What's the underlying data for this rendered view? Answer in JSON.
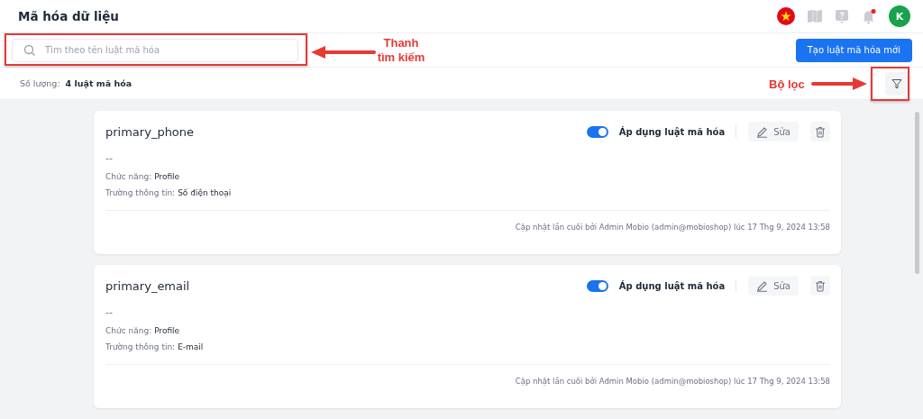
{
  "header": {
    "title": "Mã hóa dữ liệu",
    "notification_dot": true,
    "avatar": "K"
  },
  "search": {
    "placeholder": "Tìm theo tên luật mã hóa"
  },
  "create_button": "Tạo luật mã hóa mới",
  "summary": {
    "label": "Số lượng:",
    "value": "4 luật mã hóa"
  },
  "rules": [
    {
      "name": "primary_phone",
      "description": "--",
      "apply_label": "Áp dụng luật mã hóa",
      "applied": true,
      "edit_label": "Sửa",
      "function_label": "Chức năng:",
      "function": "Profile",
      "field_label": "Trường thông tin:",
      "field": "Số điện thoại",
      "updated": "Cập nhật lần cuối bởi Admin Mobio (admin@mobioshop) lúc 17 Thg 9, 2024 13:58"
    },
    {
      "name": "primary_email",
      "description": "--",
      "apply_label": "Áp dụng luật mã hóa",
      "applied": true,
      "edit_label": "Sửa",
      "function_label": "Chức năng:",
      "function": "Profile",
      "field_label": "Trường thông tin:",
      "field": "E-mail",
      "updated": "Cập nhật lần cuối bởi Admin Mobio (admin@mobioshop) lúc 17 Thg 9, 2024 13:58"
    }
  ],
  "annotations": {
    "search": {
      "lines": [
        "Thanh",
        "tìm kiếm"
      ]
    },
    "filter": {
      "lines": [
        "Bộ lọc"
      ]
    }
  }
}
